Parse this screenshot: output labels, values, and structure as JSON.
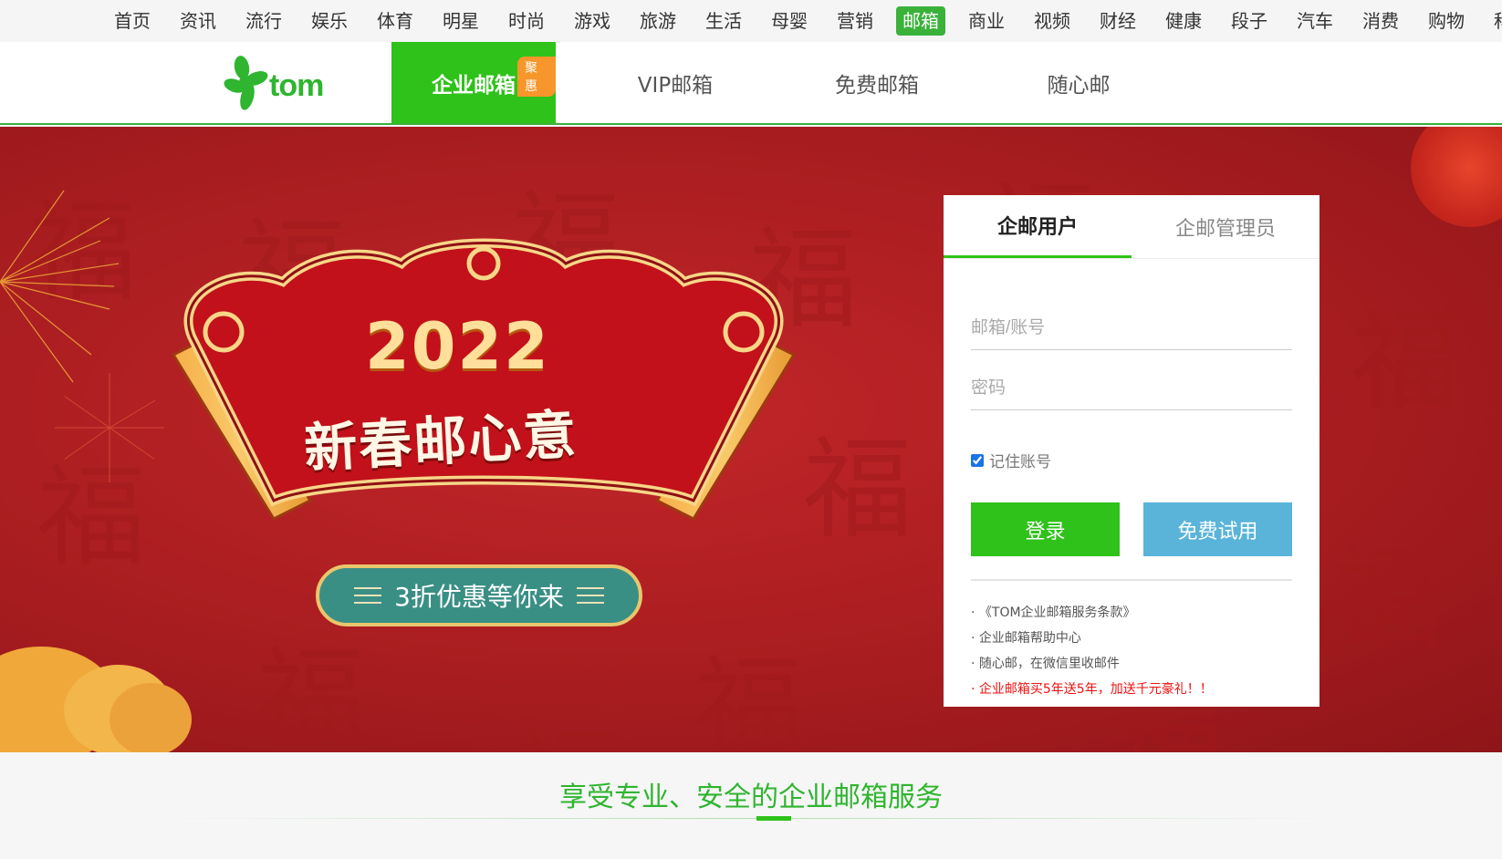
{
  "topnav": {
    "items": [
      "首页",
      "资讯",
      "流行",
      "娱乐",
      "体育",
      "明星",
      "时尚",
      "游戏",
      "旅游",
      "生活",
      "母婴",
      "营销",
      "邮箱",
      "商业",
      "视频",
      "财经",
      "健康",
      "段子",
      "汽车",
      "消费",
      "购物",
      "科技"
    ],
    "active": "邮箱"
  },
  "header": {
    "logo_text": "tom",
    "nav": {
      "enterprise": "企业邮箱",
      "promo_tag": "聚惠",
      "vip": "VIP邮箱",
      "free": "免费邮箱",
      "suixin": "随心邮"
    }
  },
  "banner": {
    "year": "2022",
    "title": "新春邮心意",
    "pill": "3折优惠等你来",
    "background_char": "福"
  },
  "login": {
    "tab_user": "企邮用户",
    "tab_admin": "企邮管理员",
    "account_placeholder": "邮箱/账号",
    "password_placeholder": "密码",
    "remember_label": "记住账号",
    "remember_checked": true,
    "login_button": "登录",
    "trial_button": "免费试用",
    "links": [
      "· 《TOM企业邮箱服务条款》",
      "· 企业邮箱帮助中心",
      "· 随心邮，在微信里收邮件",
      "· 企业邮箱买5年送5年，加送千元豪礼！！"
    ]
  },
  "footer": {
    "slogan": "享受专业、安全的企业邮箱服务"
  },
  "colors": {
    "brand_green": "#2fc21a",
    "banner_red": "#a61c1f",
    "trial_blue": "#5ab4d9",
    "promo_orange": "#f7962a"
  }
}
